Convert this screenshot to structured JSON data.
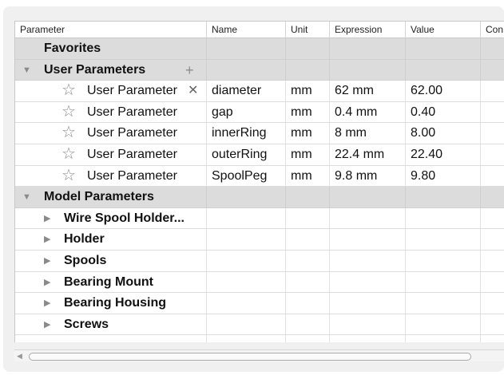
{
  "headers": {
    "parameter": "Parameter",
    "name": "Name",
    "unit": "Unit",
    "expression": "Expression",
    "value": "Value",
    "comment": "Con"
  },
  "favorites_label": "Favorites",
  "user_parameters": {
    "label": "User Parameters",
    "add_icon": "plus-icon",
    "rows": [
      {
        "label": "User Parameter",
        "name": "diameter",
        "unit": "mm",
        "expression": "62 mm",
        "value": "62.00",
        "delete_glyph": "✕"
      },
      {
        "label": "User Parameter",
        "name": "gap",
        "unit": "mm",
        "expression": "0.4 mm",
        "value": "0.40"
      },
      {
        "label": "User Parameter",
        "name": "innerRing",
        "unit": "mm",
        "expression": "8 mm",
        "value": "8.00"
      },
      {
        "label": "User Parameter",
        "name": "outerRing",
        "unit": "mm",
        "expression": "22.4 mm",
        "value": "22.40"
      },
      {
        "label": "User Parameter",
        "name": "SpoolPeg",
        "unit": "mm",
        "expression": "9.8 mm",
        "value": "9.80"
      }
    ]
  },
  "model_parameters": {
    "label": "Model Parameters",
    "items": [
      {
        "label": "Wire Spool Holder..."
      },
      {
        "label": "Holder"
      },
      {
        "label": "Spools"
      },
      {
        "label": "Bearing Mount"
      },
      {
        "label": "Bearing Housing"
      },
      {
        "label": "Screws"
      }
    ]
  },
  "icons": {
    "expanded": "triangle-down-icon",
    "collapsed": "triangle-right-icon",
    "favorite": "star-outline-icon",
    "delete": "x-icon"
  }
}
